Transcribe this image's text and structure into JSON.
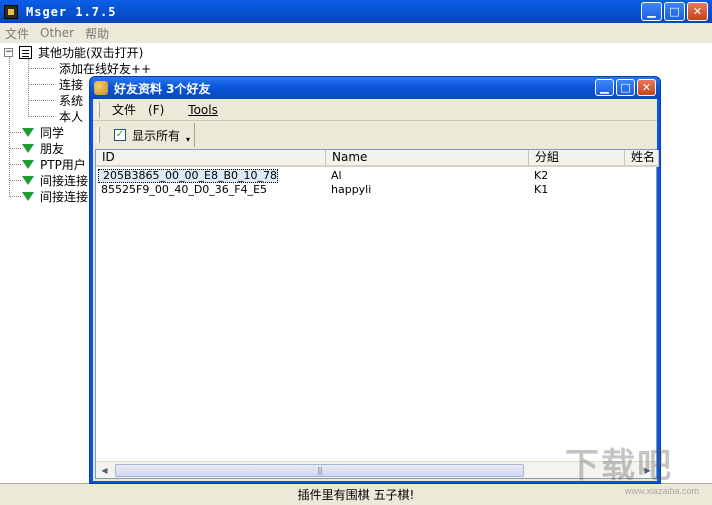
{
  "main_window": {
    "title": "Msger 1.7.5",
    "menu": [
      "文件",
      "Other",
      "帮助"
    ],
    "window_buttons": [
      "minimize",
      "maximize",
      "close"
    ]
  },
  "tree": {
    "root": {
      "label": "其他功能(双击打开)",
      "children": [
        "添加在线好友++",
        "连接",
        "系统",
        "本人"
      ]
    },
    "groups": [
      "同学",
      "朋友",
      "PTP用户",
      "间接连接",
      "间接连接"
    ]
  },
  "status_bar": {
    "text": "插件里有围棋 五子棋!"
  },
  "dialog": {
    "title": "好友资料 3个好友",
    "menu": [
      {
        "label": "文件",
        "accel": "(F)"
      },
      {
        "label": "Tools",
        "accel": ""
      }
    ],
    "toolbar": {
      "show_all_label": "显示所有",
      "show_all_checked": true,
      "check_mark": "✓",
      "dropdown_glyph": "▾"
    },
    "list": {
      "columns": [
        "ID",
        "Name",
        "分組",
        "姓名"
      ],
      "rows": [
        {
          "id": "205B3865_00_00_E8_B0_10_78",
          "name": "Al",
          "group": "K2",
          "surname": ""
        },
        {
          "id": "85525F9_00_40_D0_36_F4_E5",
          "name": "happyli",
          "group": "K1",
          "surname": ""
        }
      ],
      "scroll_left_glyph": "◀",
      "scroll_right_glyph": "▶",
      "scroll_grip": "|||"
    }
  },
  "watermark": {
    "text": "下载吧",
    "url_text": "www.xiazaiba.com"
  },
  "colors": {
    "titlebar_blue": "#0854d4",
    "tree_triangle_green": "#1e9c2e",
    "window_face": "#ece9d8"
  }
}
